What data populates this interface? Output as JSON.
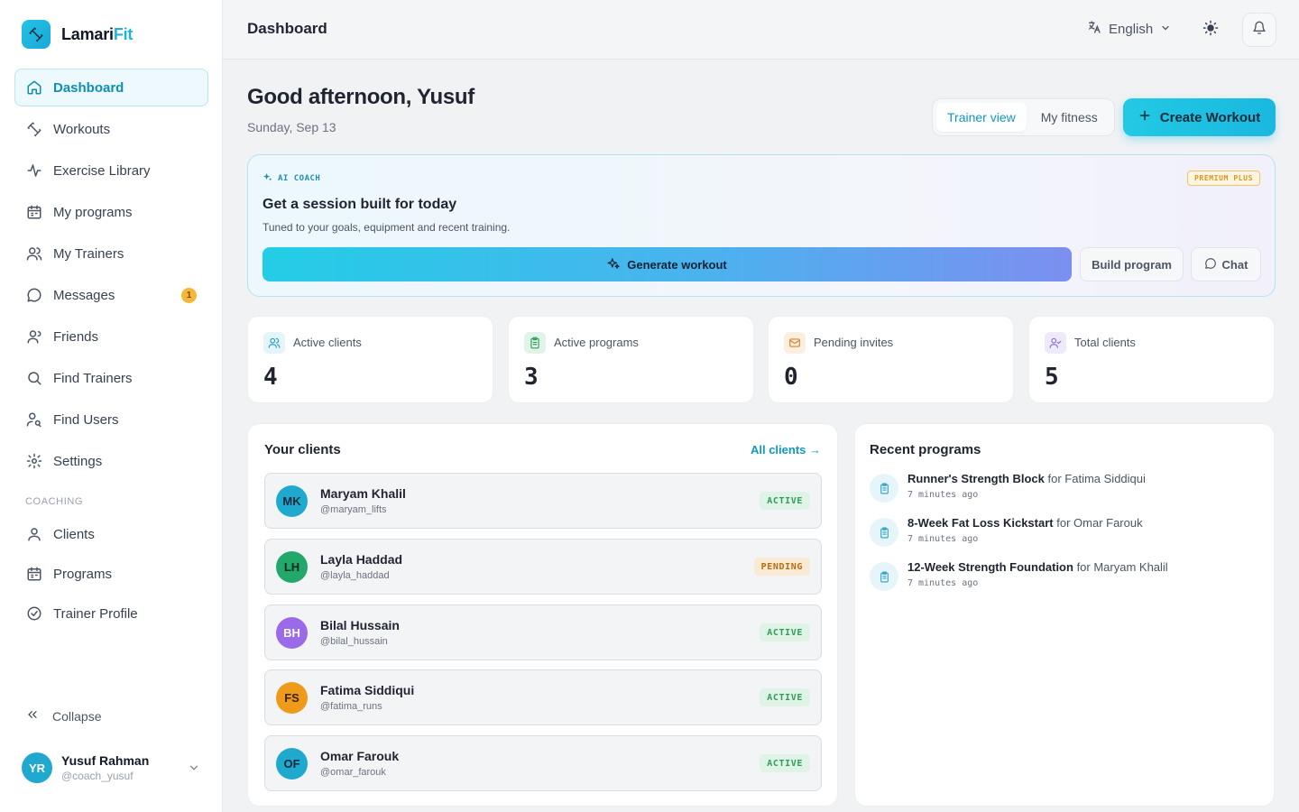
{
  "app": {
    "name_main": "Lamari",
    "name_accent": "Fit"
  },
  "sidebar": {
    "items": [
      {
        "label": "Dashboard",
        "icon": "home-icon"
      },
      {
        "label": "Workouts",
        "icon": "dumbbell-icon"
      },
      {
        "label": "Exercise Library",
        "icon": "activity-icon"
      },
      {
        "label": "My programs",
        "icon": "calendar-icon"
      },
      {
        "label": "My Trainers",
        "icon": "users-icon"
      },
      {
        "label": "Messages",
        "icon": "message-icon",
        "badge": "1"
      },
      {
        "label": "Friends",
        "icon": "friends-icon"
      },
      {
        "label": "Find Trainers",
        "icon": "search-icon"
      },
      {
        "label": "Find Users",
        "icon": "user-search-icon"
      },
      {
        "label": "Settings",
        "icon": "gear-icon"
      }
    ],
    "section_label": "COACHING",
    "coaching_items": [
      {
        "label": "Clients",
        "icon": "user-icon"
      },
      {
        "label": "Programs",
        "icon": "calendar-icon"
      },
      {
        "label": "Trainer Profile",
        "icon": "badge-check-icon"
      }
    ],
    "collapse_label": "Collapse",
    "user": {
      "initials": "YR",
      "name": "Yusuf Rahman",
      "handle": "@coach_yusuf"
    }
  },
  "topbar": {
    "title": "Dashboard",
    "language": "English"
  },
  "main": {
    "greeting": "Good afternoon, Yusuf",
    "date": "Sunday, Sep 13",
    "view_toggle": {
      "trainer": "Trainer view",
      "fitness": "My fitness"
    },
    "create_label": "Create Workout"
  },
  "ai_coach": {
    "tag": "AI COACH",
    "premium": "PREMIUM PLUS",
    "title": "Get a session built for today",
    "subtitle": "Tuned to your goals, equipment and recent training.",
    "generate_label": "Generate workout",
    "build_label": "Build program",
    "chat_label": "Chat"
  },
  "stats": [
    {
      "label": "Active clients",
      "value": "4",
      "icon": "users-icon",
      "color": "#2a9fc4",
      "bg": "#e4f5fa"
    },
    {
      "label": "Active programs",
      "value": "3",
      "icon": "clipboard-icon",
      "color": "#2f9e5b",
      "bg": "#e2f4e9"
    },
    {
      "label": "Pending invites",
      "value": "0",
      "icon": "mail-icon",
      "color": "#d9822b",
      "bg": "#fcefe0"
    },
    {
      "label": "Total clients",
      "value": "5",
      "icon": "user-check-icon",
      "color": "#8b6fd6",
      "bg": "#efeafb"
    }
  ],
  "clients": {
    "title": "Your clients",
    "all_link": "All clients →",
    "rows": [
      {
        "initials": "MK",
        "name": "Maryam Khalil",
        "handle": "@maryam_lifts",
        "status": "ACTIVE",
        "avatar_color": "#1fa9cf",
        "avatar_text": "#0b2a3a"
      },
      {
        "initials": "LH",
        "name": "Layla Haddad",
        "handle": "@layla_haddad",
        "status": "PENDING",
        "avatar_color": "#22a86a",
        "avatar_text": "#0b2a1b"
      },
      {
        "initials": "BH",
        "name": "Bilal Hussain",
        "handle": "@bilal_hussain",
        "status": "ACTIVE",
        "avatar_color": "#9b6ae8",
        "avatar_text": "#ffffff"
      },
      {
        "initials": "FS",
        "name": "Fatima Siddiqui",
        "handle": "@fatima_runs",
        "status": "ACTIVE",
        "avatar_color": "#ee9a1b",
        "avatar_text": "#3a2200"
      },
      {
        "initials": "OF",
        "name": "Omar Farouk",
        "handle": "@omar_farouk",
        "status": "ACTIVE",
        "avatar_color": "#1fa9cf",
        "avatar_text": "#0b2a3a"
      }
    ]
  },
  "programs": {
    "title": "Recent programs",
    "items": [
      {
        "name": "Runner's Strength Block",
        "for": "for Fatima Siddiqui",
        "time": "7 minutes ago"
      },
      {
        "name": "8-Week Fat Loss Kickstart",
        "for": "for Omar Farouk",
        "time": "7 minutes ago"
      },
      {
        "name": "12-Week Strength Foundation",
        "for": "for Maryam Khalil",
        "time": "7 minutes ago"
      }
    ]
  }
}
